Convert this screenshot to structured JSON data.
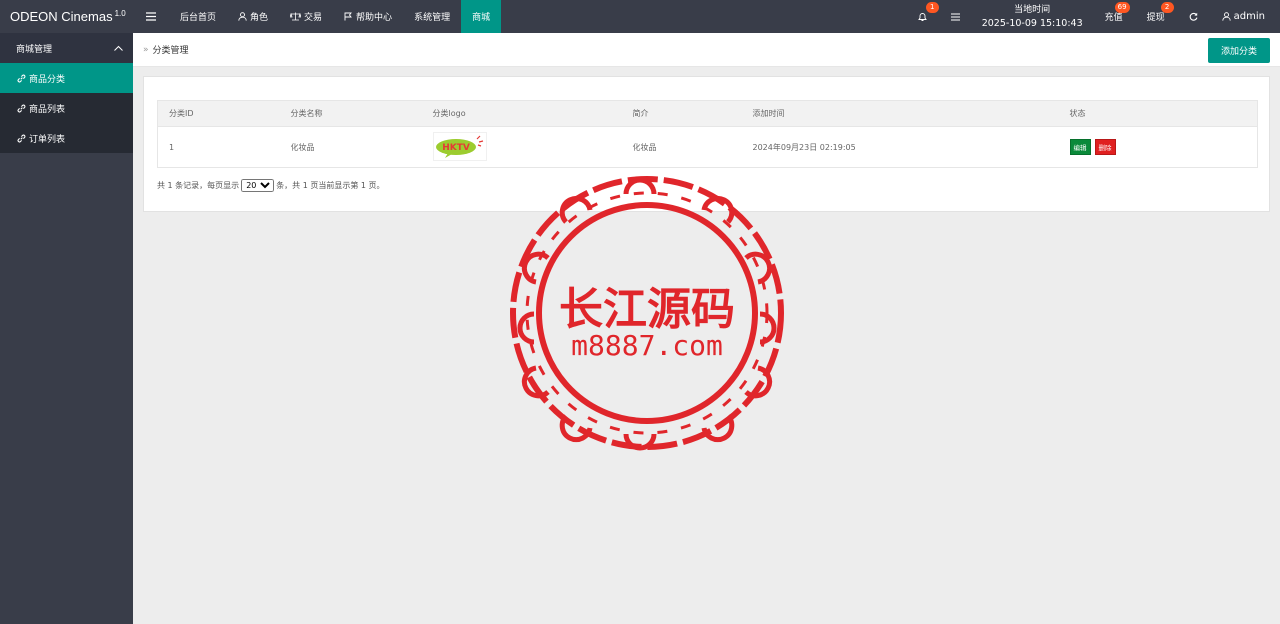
{
  "app": {
    "brand": "ODEON Cinemas",
    "version": "1.0"
  },
  "topnav": {
    "items": [
      {
        "label": "后台首页",
        "icon": "home-icon"
      },
      {
        "label": "角色",
        "icon": "user-icon"
      },
      {
        "label": "交易",
        "icon": "scale-icon"
      },
      {
        "label": "帮助中心",
        "icon": "flag-icon"
      },
      {
        "label": "系统管理",
        "icon": ""
      },
      {
        "label": "商城",
        "icon": "",
        "active": true
      }
    ]
  },
  "header_right": {
    "notify_count": "1",
    "time_label": "当地时间",
    "time_value": "2025-10-09 15:10:43",
    "recharge_label": "充值",
    "recharge_count": "69",
    "withdraw_label": "提现",
    "withdraw_count": "2",
    "user": "admin"
  },
  "sidebar": {
    "group": "商城管理",
    "items": [
      {
        "label": "商品分类",
        "active": true
      },
      {
        "label": "商品列表"
      },
      {
        "label": "订单列表"
      }
    ]
  },
  "breadcrumb": {
    "current": "分类管理"
  },
  "toolbar": {
    "add_label": "添加分类"
  },
  "table": {
    "headers": [
      "分类ID",
      "分类名称",
      "分类logo",
      "简介",
      "添加时间",
      "状态"
    ],
    "rows": [
      {
        "id": "1",
        "name": "化妆品",
        "logo_text": "HKTV",
        "intro": "化妆品",
        "time": "2024年09月23日 02:19:05",
        "edit": "编辑",
        "delete": "删除"
      }
    ]
  },
  "pager": {
    "prefix": "共 1 条记录，每页显示",
    "page_size": "20",
    "suffix": "条，共 1 页当前显示第 1 页。"
  },
  "watermark": {
    "line1": "长江源码",
    "line2": "m8887.com"
  },
  "colors": {
    "accent": "#009688",
    "header": "#393d49",
    "badge": "#ff5722",
    "edit": "#0a8a3a",
    "delete": "#e02020",
    "stamp": "#e0262b"
  }
}
